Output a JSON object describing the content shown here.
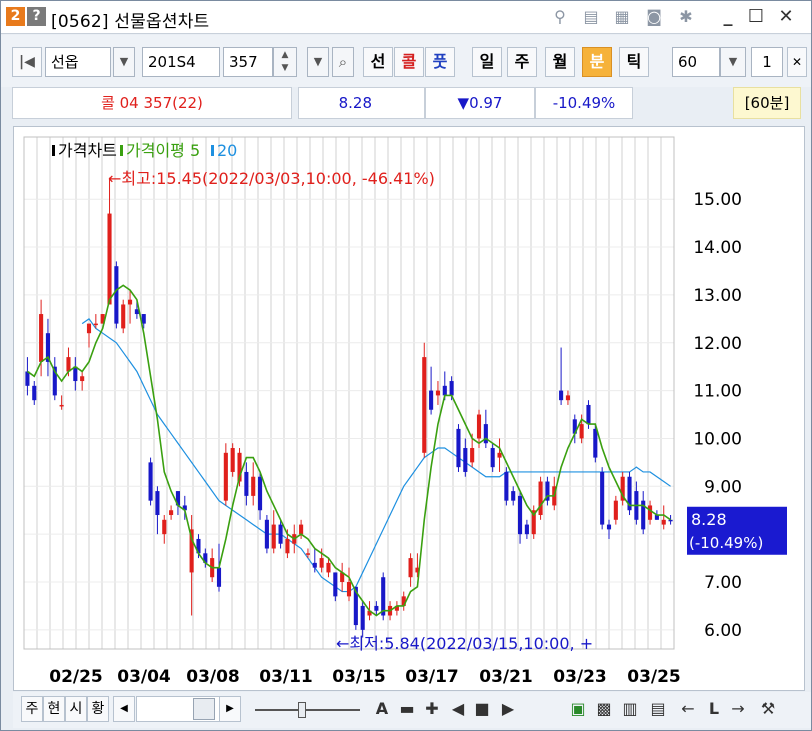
{
  "window": {
    "badge_number": "2",
    "badge_help": "?",
    "title": "[0562] 선물옵션차트"
  },
  "toolbar": {
    "product": "선옵",
    "code": "201S4",
    "strike": "357",
    "btn_sun": "선",
    "btn_call": "콜",
    "btn_put": "풋",
    "period_day": "일",
    "period_week": "주",
    "period_month": "월",
    "period_min": "분",
    "period_tick": "틱",
    "interval": "60",
    "count": "1"
  },
  "info": {
    "symbol": "콜 04 357(22)",
    "price": "8.28",
    "change": "▼0.97",
    "change_pct": "-10.49%",
    "period_label": "[60분]"
  },
  "chart_data": {
    "type": "candlestick",
    "legend": [
      {
        "name": "가격차트",
        "color": "#000000"
      },
      {
        "name": "가격이평 5",
        "color": "#3aa010"
      },
      {
        "name": "20",
        "color": "#1e90e0"
      }
    ],
    "y_ticks": [
      "15.00",
      "14.00",
      "13.00",
      "12.00",
      "11.00",
      "10.00",
      "9.00",
      "8.00",
      "7.00",
      "6.00"
    ],
    "ylim": [
      5.6,
      16.3
    ],
    "x_ticks": [
      "02/25",
      "03/04",
      "03/08",
      "03/11",
      "03/15",
      "03/17",
      "03/21",
      "03/23",
      "03/25"
    ],
    "high_annotation": "←최고:15.45(2022/03/03,10:00, -46.41%)",
    "low_annotation": "←최저:5.84(2022/03/15,10:00,  +",
    "last_price_label": "8.28",
    "last_change_label": "(-10.49%)",
    "colors": {
      "up": "#e0201c",
      "down": "#1818c8",
      "ma5": "#3aa010",
      "ma20": "#1e90e0",
      "grid": "#d0d0d0",
      "last_box": "#1a1ad0"
    },
    "candles": [
      [
        11.7,
        10.9,
        11.4,
        11.1
      ],
      [
        11.2,
        10.7,
        11.1,
        10.8
      ],
      [
        12.9,
        11.3,
        11.6,
        12.6
      ],
      [
        12.5,
        11.3,
        12.2,
        11.6
      ],
      [
        11.7,
        10.8,
        11.5,
        10.9
      ],
      [
        10.9,
        10.6,
        10.7,
        10.7
      ],
      [
        11.9,
        11.3,
        11.4,
        11.7
      ],
      [
        11.7,
        11.0,
        11.5,
        11.2
      ],
      [
        11.4,
        11.0,
        11.2,
        11.3
      ],
      [
        12.4,
        11.9,
        12.2,
        12.4
      ],
      [
        12.6,
        12.3,
        12.4,
        12.4
      ],
      [
        12.6,
        12.4,
        12.4,
        12.6
      ],
      [
        15.45,
        12.8,
        12.8,
        14.7
      ],
      [
        13.7,
        12.3,
        13.6,
        12.4
      ],
      [
        12.9,
        12.2,
        12.3,
        12.8
      ],
      [
        13.1,
        12.4,
        12.8,
        12.9
      ],
      [
        12.9,
        12.5,
        12.7,
        12.6
      ],
      [
        12.6,
        12.3,
        12.6,
        12.4
      ],
      [
        9.6,
        8.6,
        9.5,
        8.7
      ],
      [
        9.0,
        8.0,
        8.9,
        8.4
      ],
      [
        8.4,
        7.8,
        8.0,
        8.3
      ],
      [
        8.6,
        8.3,
        8.4,
        8.5
      ],
      [
        8.9,
        8.4,
        8.9,
        8.6
      ],
      [
        8.8,
        8.3,
        8.6,
        8.5
      ],
      [
        8.4,
        6.3,
        7.2,
        8.1
      ],
      [
        8.0,
        7.5,
        7.9,
        7.6
      ],
      [
        7.7,
        7.3,
        7.6,
        7.4
      ],
      [
        7.7,
        7.0,
        7.1,
        7.5
      ],
      [
        7.8,
        6.8,
        7.3,
        6.9
      ],
      [
        9.9,
        8.6,
        8.7,
        9.7
      ],
      [
        9.9,
        9.2,
        9.3,
        9.8
      ],
      [
        9.8,
        9.0,
        9.1,
        9.7
      ],
      [
        9.5,
        8.6,
        9.3,
        8.8
      ],
      [
        9.5,
        8.6,
        8.8,
        9.2
      ],
      [
        9.3,
        8.3,
        9.2,
        8.5
      ],
      [
        8.4,
        7.6,
        8.3,
        7.7
      ],
      [
        8.5,
        7.6,
        7.7,
        8.2
      ],
      [
        8.3,
        7.7,
        8.2,
        7.8
      ],
      [
        8.1,
        7.5,
        7.6,
        7.9
      ],
      [
        8.2,
        7.6,
        7.8,
        8.0
      ],
      [
        8.3,
        7.9,
        8.0,
        8.2
      ],
      [
        7.7,
        7.5,
        7.6,
        7.6
      ],
      [
        7.7,
        7.2,
        7.4,
        7.3
      ],
      [
        7.7,
        7.2,
        7.3,
        7.5
      ],
      [
        7.5,
        7.1,
        7.2,
        7.4
      ],
      [
        7.2,
        6.6,
        7.2,
        6.7
      ],
      [
        7.4,
        6.8,
        7.0,
        7.2
      ],
      [
        7.3,
        6.6,
        6.7,
        7.0
      ],
      [
        6.9,
        6.0,
        6.9,
        6.1
      ],
      [
        6.6,
        5.84,
        6.5,
        6.0
      ],
      [
        6.6,
        6.2,
        6.3,
        6.4
      ],
      [
        6.6,
        6.3,
        6.5,
        6.4
      ],
      [
        7.2,
        6.2,
        7.1,
        6.3
      ],
      [
        6.6,
        6.2,
        6.3,
        6.5
      ],
      [
        6.6,
        6.3,
        6.4,
        6.5
      ],
      [
        6.8,
        6.4,
        6.5,
        6.7
      ],
      [
        7.6,
        6.9,
        7.1,
        7.5
      ],
      [
        7.6,
        7.1,
        7.2,
        7.3
      ],
      [
        12.0,
        9.6,
        9.7,
        11.7
      ],
      [
        11.5,
        10.5,
        11.0,
        10.6
      ],
      [
        11.2,
        10.7,
        10.9,
        11.0
      ],
      [
        11.4,
        10.8,
        11.1,
        10.9
      ],
      [
        11.3,
        10.8,
        11.2,
        10.9
      ],
      [
        10.3,
        9.3,
        10.2,
        9.4
      ],
      [
        10.0,
        9.2,
        9.8,
        9.3
      ],
      [
        10.1,
        9.4,
        9.5,
        9.8
      ],
      [
        10.6,
        9.8,
        10.0,
        10.5
      ],
      [
        10.6,
        9.8,
        10.3,
        9.9
      ],
      [
        9.9,
        9.3,
        9.8,
        9.4
      ],
      [
        10.0,
        9.3,
        9.6,
        9.7
      ],
      [
        9.4,
        8.6,
        9.3,
        8.7
      ],
      [
        9.0,
        8.6,
        8.9,
        8.7
      ],
      [
        8.9,
        7.8,
        8.8,
        8.0
      ],
      [
        8.3,
        7.9,
        8.2,
        8.0
      ],
      [
        8.6,
        7.9,
        8.0,
        8.5
      ],
      [
        9.2,
        8.3,
        8.4,
        9.1
      ],
      [
        9.2,
        8.6,
        9.1,
        8.7
      ],
      [
        9.2,
        8.5,
        8.6,
        9.0
      ],
      [
        11.9,
        10.7,
        11.0,
        10.8
      ],
      [
        11.0,
        10.7,
        10.8,
        10.9
      ],
      [
        10.5,
        9.9,
        10.4,
        10.1
      ],
      [
        10.5,
        9.9,
        10.0,
        10.3
      ],
      [
        10.8,
        10.2,
        10.7,
        10.3
      ],
      [
        10.3,
        9.5,
        10.2,
        9.6
      ],
      [
        9.4,
        8.1,
        9.3,
        8.2
      ],
      [
        8.3,
        7.9,
        8.2,
        8.1
      ],
      [
        8.8,
        8.2,
        8.3,
        8.7
      ],
      [
        9.3,
        8.6,
        8.7,
        9.2
      ],
      [
        9.3,
        8.4,
        9.2,
        8.5
      ],
      [
        9.1,
        8.2,
        8.9,
        8.3
      ],
      [
        8.9,
        8.0,
        8.7,
        8.1
      ],
      [
        8.7,
        8.2,
        8.3,
        8.6
      ],
      [
        8.5,
        8.3,
        8.4,
        8.3
      ],
      [
        8.6,
        8.1,
        8.2,
        8.3
      ],
      [
        8.4,
        8.2,
        8.3,
        8.28
      ]
    ],
    "ma5": [
      11.4,
      11.3,
      11.6,
      11.7,
      11.4,
      11.2,
      11.4,
      11.5,
      11.4,
      11.6,
      12.0,
      12.3,
      12.9,
      13.1,
      13.2,
      13.1,
      12.9,
      12.2,
      11.3,
      10.4,
      9.3,
      8.9,
      8.6,
      8.5,
      7.9,
      7.6,
      7.4,
      7.3,
      7.3,
      7.9,
      8.6,
      9.2,
      9.6,
      9.6,
      9.3,
      8.9,
      8.6,
      8.3,
      8.0,
      7.9,
      8.0,
      7.9,
      7.7,
      7.6,
      7.5,
      7.3,
      7.2,
      7.1,
      6.8,
      6.6,
      6.4,
      6.3,
      6.4,
      6.4,
      6.5,
      6.5,
      6.8,
      6.9,
      8.3,
      9.4,
      10.3,
      10.9,
      10.9,
      10.6,
      10.3,
      10.0,
      9.9,
      10.0,
      9.9,
      9.8,
      9.5,
      9.2,
      8.9,
      8.6,
      8.4,
      8.6,
      8.8,
      8.8,
      9.4,
      9.8,
      10.1,
      10.4,
      10.3,
      10.3,
      9.8,
      9.4,
      9.1,
      8.8,
      8.6,
      8.6,
      8.6,
      8.5,
      8.4,
      8.4,
      8.3
    ],
    "ma20_start_index": 8,
    "ma20": [
      12.4,
      12.5,
      12.3,
      12.2,
      12.1,
      12.0,
      11.8,
      11.6,
      11.4,
      11.1,
      10.8,
      10.5,
      10.3,
      10.1,
      9.9,
      9.7,
      9.5,
      9.3,
      9.1,
      8.9,
      8.7,
      8.6,
      8.5,
      8.4,
      8.3,
      8.2,
      8.1,
      8.0,
      8.0,
      8.0,
      7.9,
      7.8,
      7.7,
      7.5,
      7.3,
      7.1,
      7.0,
      6.9,
      6.8,
      6.8,
      6.9,
      7.2,
      7.5,
      7.8,
      8.1,
      8.4,
      8.7,
      9.0,
      9.2,
      9.4,
      9.6,
      9.7,
      9.8,
      9.8,
      9.7,
      9.6,
      9.5,
      9.4,
      9.3,
      9.2,
      9.2,
      9.2,
      9.3,
      9.3,
      9.3,
      9.3,
      9.3,
      9.3,
      9.3,
      9.3,
      9.3,
      9.3,
      9.3,
      9.3,
      9.3,
      9.3,
      9.3,
      9.3,
      9.3,
      9.3,
      9.3,
      9.4,
      9.3,
      9.3,
      9.2,
      9.1,
      9.0
    ]
  },
  "bottombar": {
    "btn_ju": "주",
    "btn_hyeon": "현",
    "btn_si": "시",
    "btn_hwang": "황",
    "text_a": "A"
  }
}
